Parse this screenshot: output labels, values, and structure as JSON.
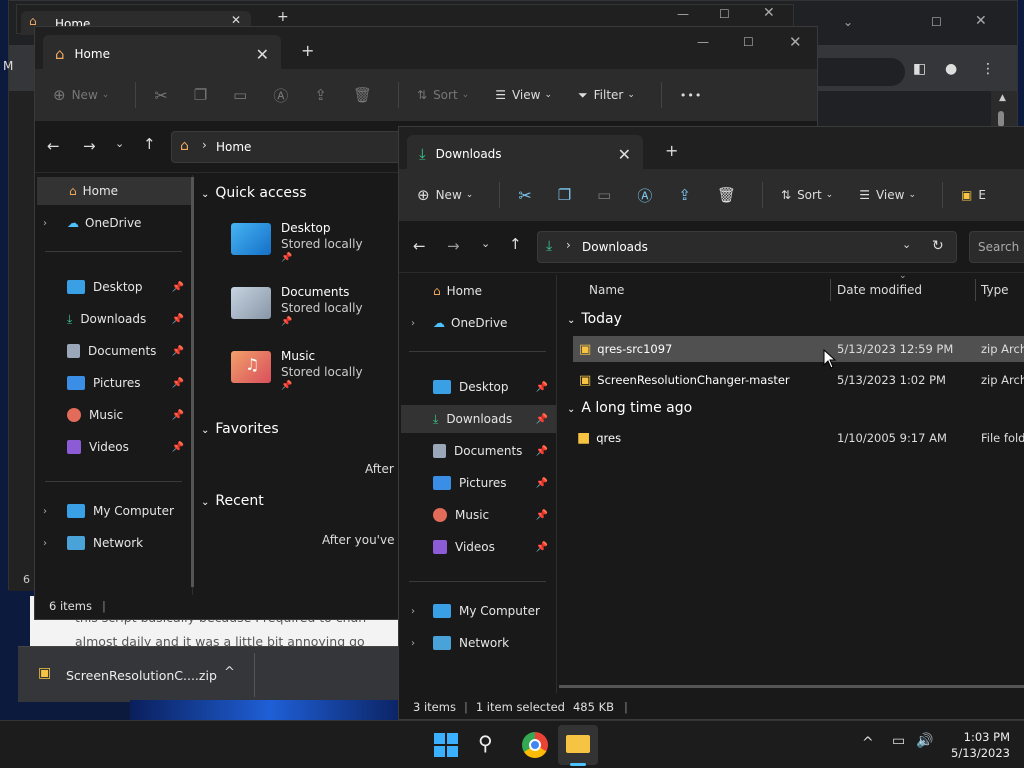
{
  "colors": {
    "accent": "#4cc2ff",
    "folder": "#f6c343",
    "desktop_bg": "#0b1a3d"
  },
  "back_window": {
    "tab_label": "Home"
  },
  "back_browser": {
    "left_text": "M",
    "article_line1": "this script basically because I required to chan",
    "article_line2": "almost daily and it was a little bit annoying go",
    "side_count": "6 i"
  },
  "download_bar": {
    "file_label": "ScreenResolutionC....zip"
  },
  "home_window": {
    "tab_label": "Home",
    "toolbar": {
      "new": "New",
      "sort": "Sort",
      "view": "View",
      "filter": "Filter",
      "more": "•••"
    },
    "address": {
      "location": "Home"
    },
    "nav": {
      "home": "Home",
      "onedrive": "OneDrive",
      "pinned": [
        "Desktop",
        "Downloads",
        "Documents",
        "Pictures",
        "Music",
        "Videos"
      ],
      "my_computer": "My Computer",
      "network": "Network"
    },
    "quick_access": {
      "header": "Quick access",
      "items": [
        {
          "name": "Desktop",
          "sub": "Stored locally"
        },
        {
          "name": "Documents",
          "sub": "Stored locally"
        },
        {
          "name": "Music",
          "sub": "Stored locally"
        }
      ]
    },
    "favorites": {
      "header": "Favorites",
      "empty_text": "After y"
    },
    "recent": {
      "header": "Recent",
      "empty_text": "After you've op"
    },
    "status": {
      "items": "6 items"
    }
  },
  "downloads_window": {
    "tab_label": "Downloads",
    "toolbar": {
      "new": "New",
      "sort": "Sort",
      "view": "View",
      "extra": "E"
    },
    "address": {
      "location": "Downloads",
      "search_placeholder": "Search D"
    },
    "nav": {
      "home": "Home",
      "onedrive": "OneDrive",
      "pinned": [
        "Desktop",
        "Downloads",
        "Documents",
        "Pictures",
        "Music",
        "Videos"
      ],
      "my_computer": "My Computer",
      "network": "Network"
    },
    "columns": {
      "name": "Name",
      "date": "Date modified",
      "type": "Type"
    },
    "groups": [
      {
        "label": "Today",
        "files": [
          {
            "name": "qres-src1097",
            "date": "5/13/2023 12:59 PM",
            "type": "zip Arch"
          },
          {
            "name": "ScreenResolutionChanger-master",
            "date": "5/13/2023 1:02 PM",
            "type": "zip Arch"
          }
        ]
      },
      {
        "label": "A long time ago",
        "files": [
          {
            "name": "qres",
            "date": "1/10/2005 9:17 AM",
            "type": "File fold"
          }
        ]
      }
    ],
    "status": {
      "items": "3 items",
      "selected": "1 item selected",
      "size": "485 KB"
    }
  },
  "taskbar": {
    "time": "1:03 PM",
    "date": "5/13/2023"
  }
}
